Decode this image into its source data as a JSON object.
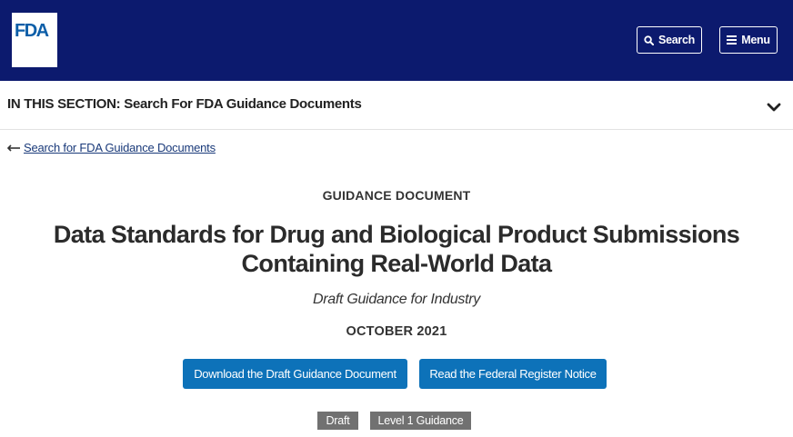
{
  "header": {
    "logo_text": "FDA",
    "search_label": "Search",
    "menu_label": "Menu",
    "background_color": "#0c1a6e"
  },
  "section": {
    "label": "IN THIS SECTION: Search For FDA Guidance Documents"
  },
  "back_link": {
    "label": "Search for FDA Guidance Documents"
  },
  "document": {
    "type": "GUIDANCE DOCUMENT",
    "title": "Data Standards for Drug and Biological Product Submissions Containing Real-World Data",
    "subtitle": "Draft Guidance for Industry",
    "date": "OCTOBER 2021"
  },
  "actions": {
    "download_label": "Download the Draft Guidance Document",
    "notice_label": "Read the Federal Register Notice",
    "button_color": "#0d72b9"
  },
  "tags": [
    "Draft",
    "Level 1 Guidance"
  ],
  "icons": {
    "search": "search-icon",
    "menu": "hamburger-icon",
    "chevron": "chevron-down-icon",
    "back": "arrow-left-icon"
  }
}
